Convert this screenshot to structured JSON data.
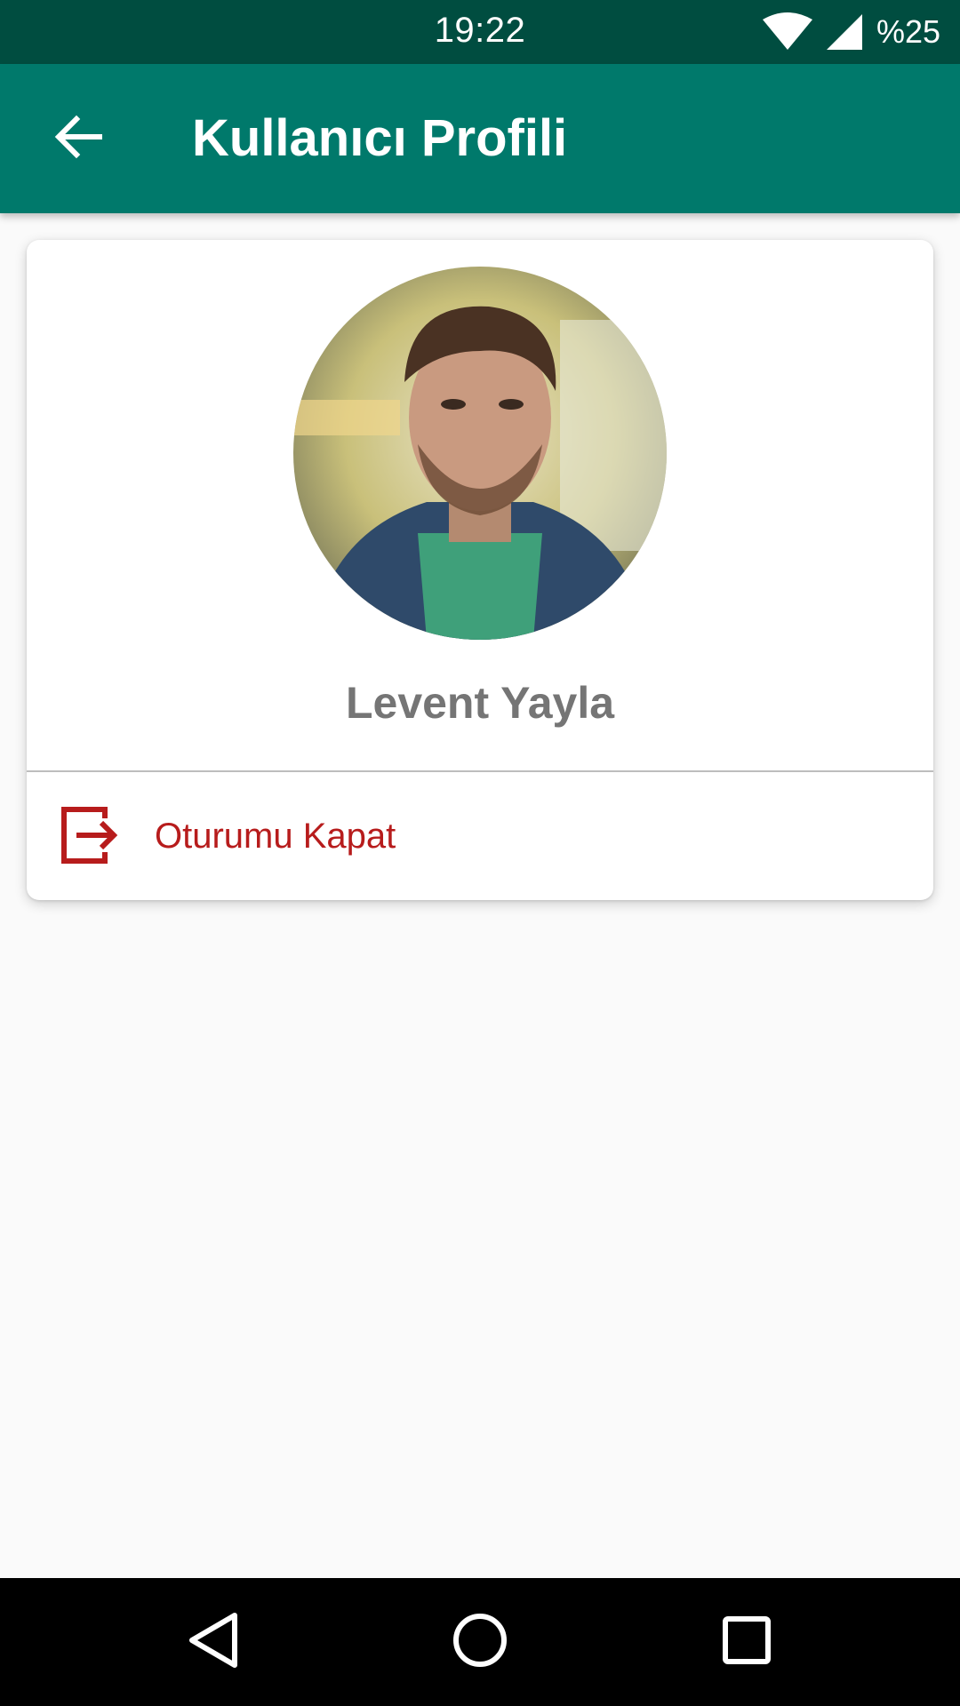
{
  "status_bar": {
    "time": "19:22",
    "battery_text": "%25",
    "icons": [
      "wifi-icon",
      "cell-signal-icon"
    ]
  },
  "app_bar": {
    "title": "Kullanıcı Profili",
    "back_icon": "arrow-back-icon"
  },
  "profile": {
    "avatar_icon": "profile-photo",
    "name": "Levent Yayla",
    "logout_label": "Oturumu Kapat",
    "logout_icon": "exit-icon"
  },
  "nav_bar": {
    "icons": [
      "back-triangle-icon",
      "home-circle-icon",
      "recents-square-icon"
    ]
  },
  "colors": {
    "status_bar": "#004d40",
    "app_bar": "#00796b",
    "logout_red": "#b71c1c",
    "name_gray": "#757575",
    "background": "#fafafa"
  }
}
